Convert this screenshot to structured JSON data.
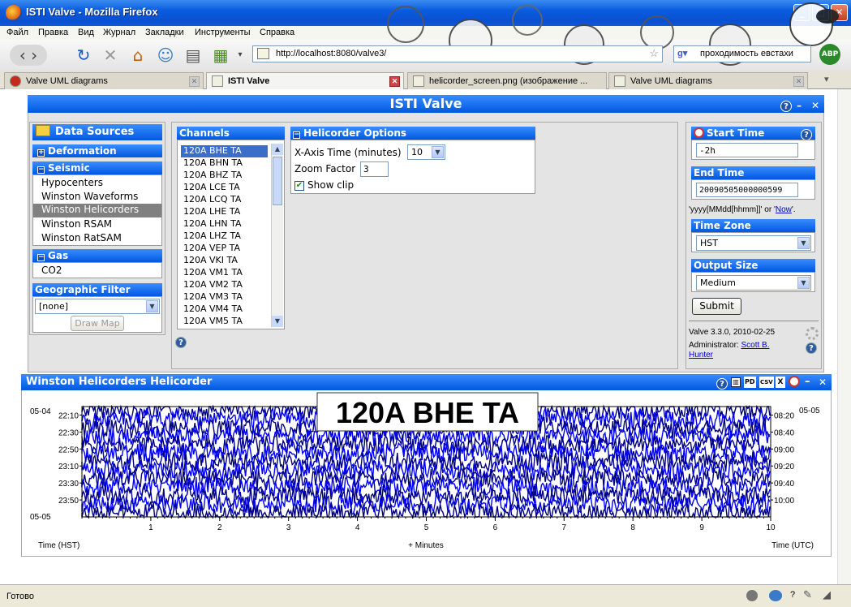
{
  "window": {
    "title": "ISTI Valve - Mozilla Firefox"
  },
  "menu": [
    "Файл",
    "Правка",
    "Вид",
    "Журнал",
    "Закладки",
    "Инструменты",
    "Справка"
  ],
  "address": {
    "url": "http://localhost:8080/valve3/"
  },
  "search": {
    "value": "проходимость евстахи"
  },
  "addon": {
    "abp": "ABP"
  },
  "tabs": [
    {
      "label": "Valve UML diagrams",
      "active": false
    },
    {
      "label": "ISTI Valve",
      "active": true
    },
    {
      "label": "helicorder_screen.png (изображение ...",
      "active": false
    },
    {
      "label": "Valve UML diagrams",
      "active": false
    }
  ],
  "valve": {
    "title": "ISTI Valve",
    "data_sources": {
      "title": "Data Sources",
      "groups": [
        {
          "label": "Deformation",
          "expanded": false
        },
        {
          "label": "Seismic",
          "expanded": true,
          "items": [
            "Hypocenters",
            "Winston Waveforms",
            "Winston Helicorders",
            "Winston RSAM",
            "Winston RatSAM"
          ],
          "selected": "Winston Helicorders"
        },
        {
          "label": "Gas",
          "expanded": true,
          "items": [
            "CO2"
          ]
        }
      ],
      "geo_filter": {
        "title": "Geographic Filter",
        "value": "[none]",
        "draw_map": "Draw Map"
      }
    },
    "channels": {
      "title": "Channels",
      "items": [
        "120A BHE TA",
        "120A BHN TA",
        "120A BHZ TA",
        "120A LCE TA",
        "120A LCQ TA",
        "120A LHE TA",
        "120A LHN TA",
        "120A LHZ TA",
        "120A VEP TA",
        "120A VKI TA",
        "120A VM1 TA",
        "120A VM2 TA",
        "120A VM3 TA",
        "120A VM4 TA",
        "120A VM5 TA"
      ],
      "selected": "120A BHE TA"
    },
    "helicorder_options": {
      "title": "Helicorder Options",
      "x_axis_label": "X-Axis Time (minutes)",
      "x_axis_value": "10",
      "zoom_label": "Zoom Factor",
      "zoom_value": "3",
      "show_clip_label": "Show clip",
      "show_clip_checked": true
    },
    "time": {
      "start_title": "Start Time",
      "start_value": "-2h",
      "end_title": "End Time",
      "end_value": "20090505000000599",
      "hint_a": "'yyyy[MMdd[hhmm]]' or '",
      "hint_now": "Now",
      "hint_b": "'.",
      "timezone_title": "Time Zone",
      "timezone_value": "HST",
      "output_title": "Output Size",
      "output_value": "Medium",
      "submit": "Submit"
    },
    "footer": {
      "version": "Valve 3.3.0, 2010-02-25",
      "admin_label": "Administrator:",
      "admin_name": "Scott B. Hunter"
    }
  },
  "helicorder": {
    "title": "Winston Helicorders Helicorder",
    "toolbar_icons": [
      "PD",
      "CSV",
      "X"
    ],
    "chart_title": "120A BHE TA"
  },
  "chart_data": {
    "type": "line",
    "title": "120A BHE TA",
    "xlabel": "+ Minutes",
    "x_ticks": [
      1,
      2,
      3,
      4,
      5,
      6,
      7,
      8,
      9,
      10
    ],
    "xlim": [
      0,
      10
    ],
    "left_axis_label": "Time (HST)",
    "right_axis_label": "Time (UTC)",
    "left_date_top": "05-04",
    "left_date_bottom": "05-05",
    "right_date_top": "05-05",
    "left_ticks": [
      "22:10",
      "22:30",
      "22:50",
      "23:10",
      "23:30",
      "23:50"
    ],
    "right_ticks": [
      "08:20",
      "08:40",
      "09:00",
      "09:20",
      "09:40",
      "10:00"
    ],
    "rows": 13,
    "row_colors": [
      "#000080",
      "#0000ff"
    ]
  },
  "status": {
    "text": "Готово"
  }
}
